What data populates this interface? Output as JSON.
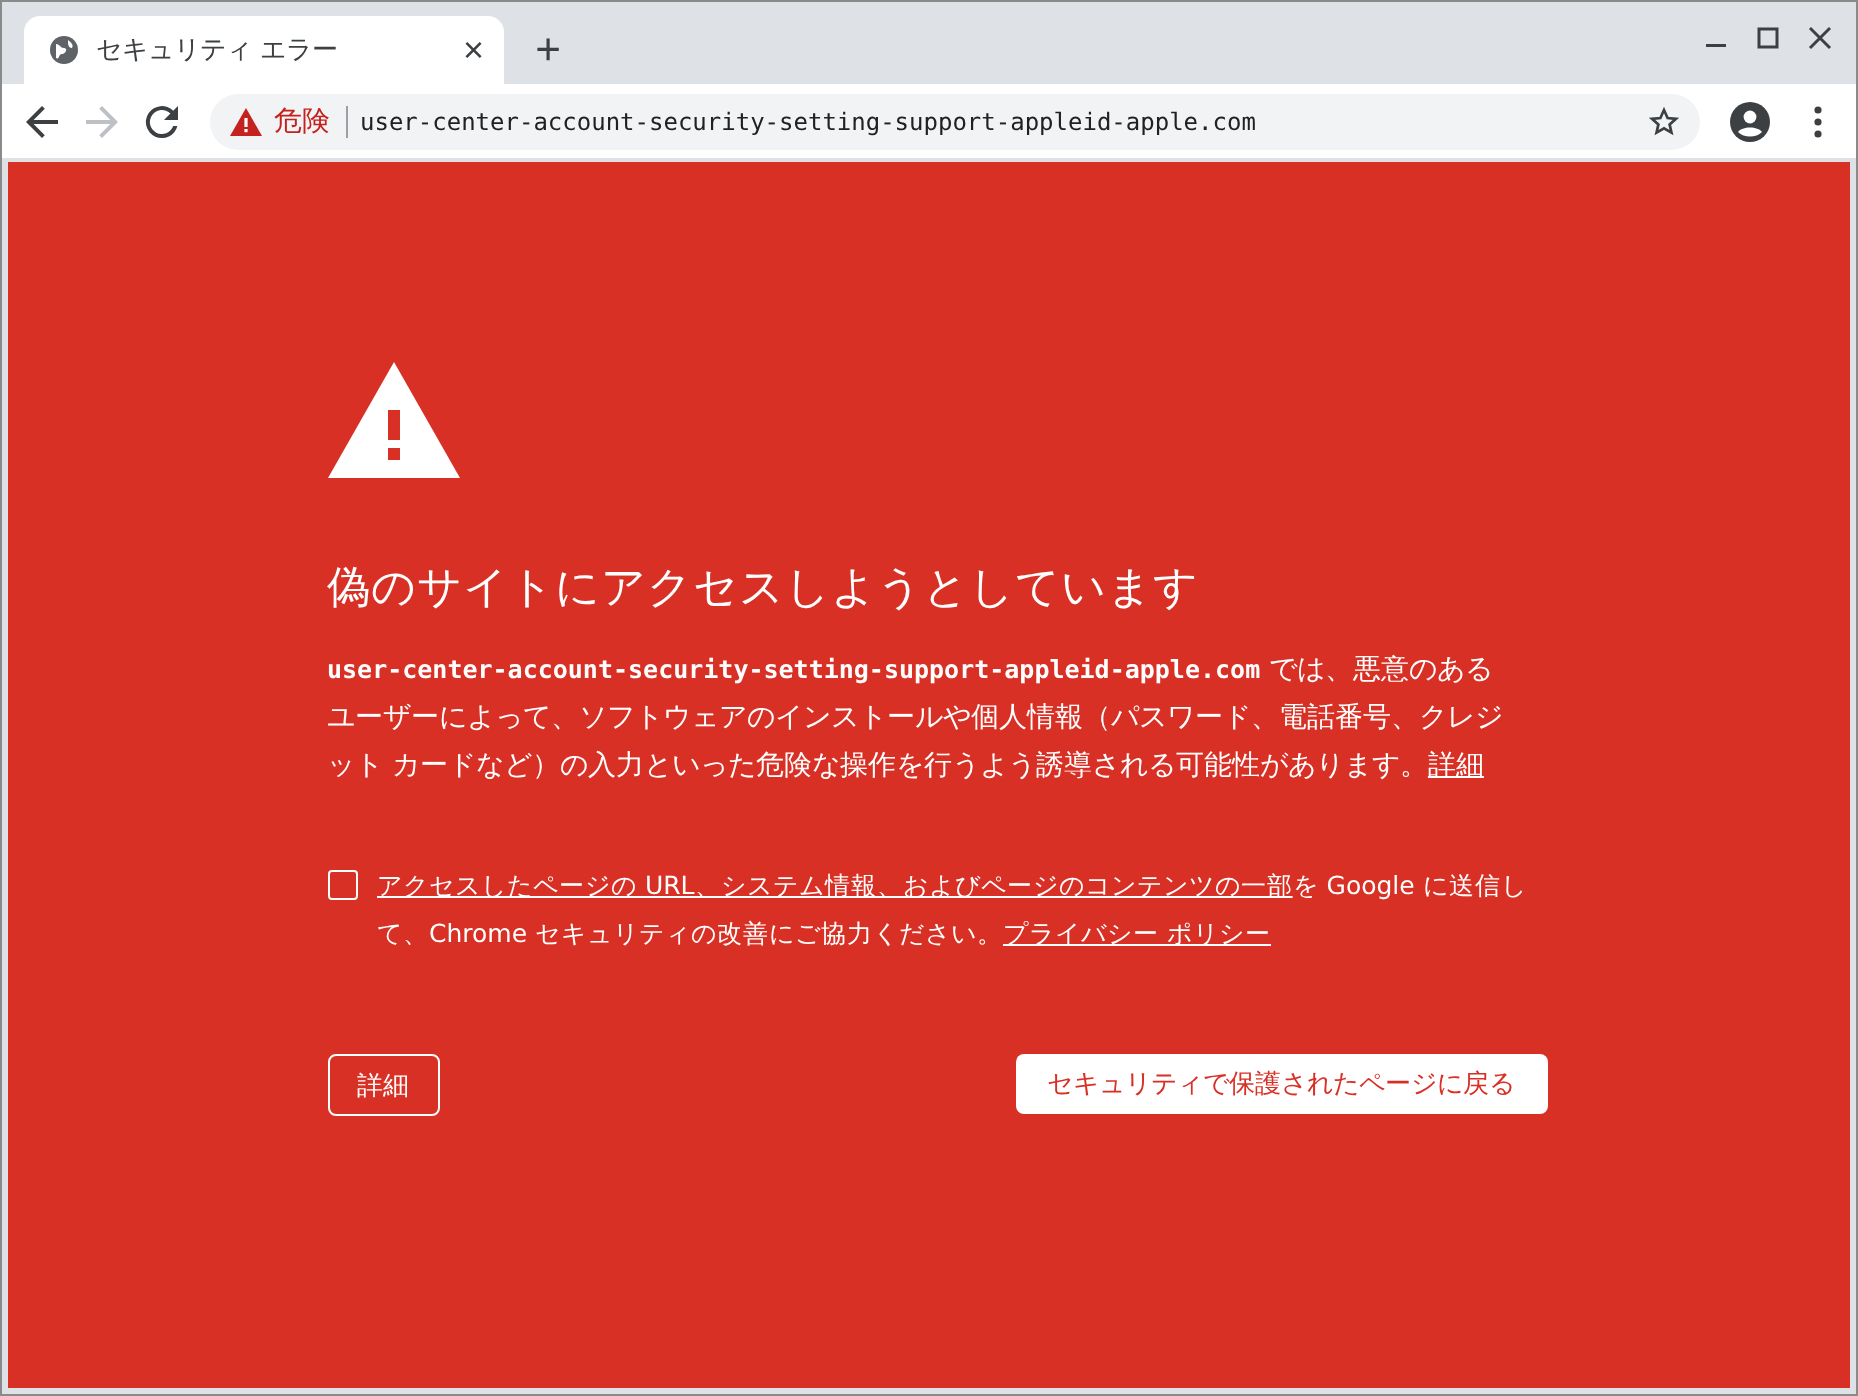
{
  "tab": {
    "title": "セキュリティ エラー",
    "close": "×",
    "new_tab": "+"
  },
  "address_bar": {
    "security_label": "危険",
    "url": "user-center-account-security-setting-support-appleid-apple.com"
  },
  "interstitial": {
    "heading": "偽のサイトにアクセスしようとしています",
    "body": "**user-center-account-security-setting-support-appleid-apple.com** では、悪意のあるユーザーによって、ソフトウェアのインストールや個人情報（パスワード、電話番号、クレジット カードなど）の入力といった危険な操作を行うよう誘導される可能性があります。",
    "details_link": "詳細",
    "report": {
      "checked": false,
      "link": "アクセスしたページの URL、システム情報、およびページのコンテンツの一部",
      "text": "を Google に送信して、Chrome セキュリティの改善にご協力ください。",
      "policy_link": "プライバシー ポリシー"
    },
    "details_button": "詳細",
    "back_button": "セキュリティで保護されたページに戻る"
  }
}
